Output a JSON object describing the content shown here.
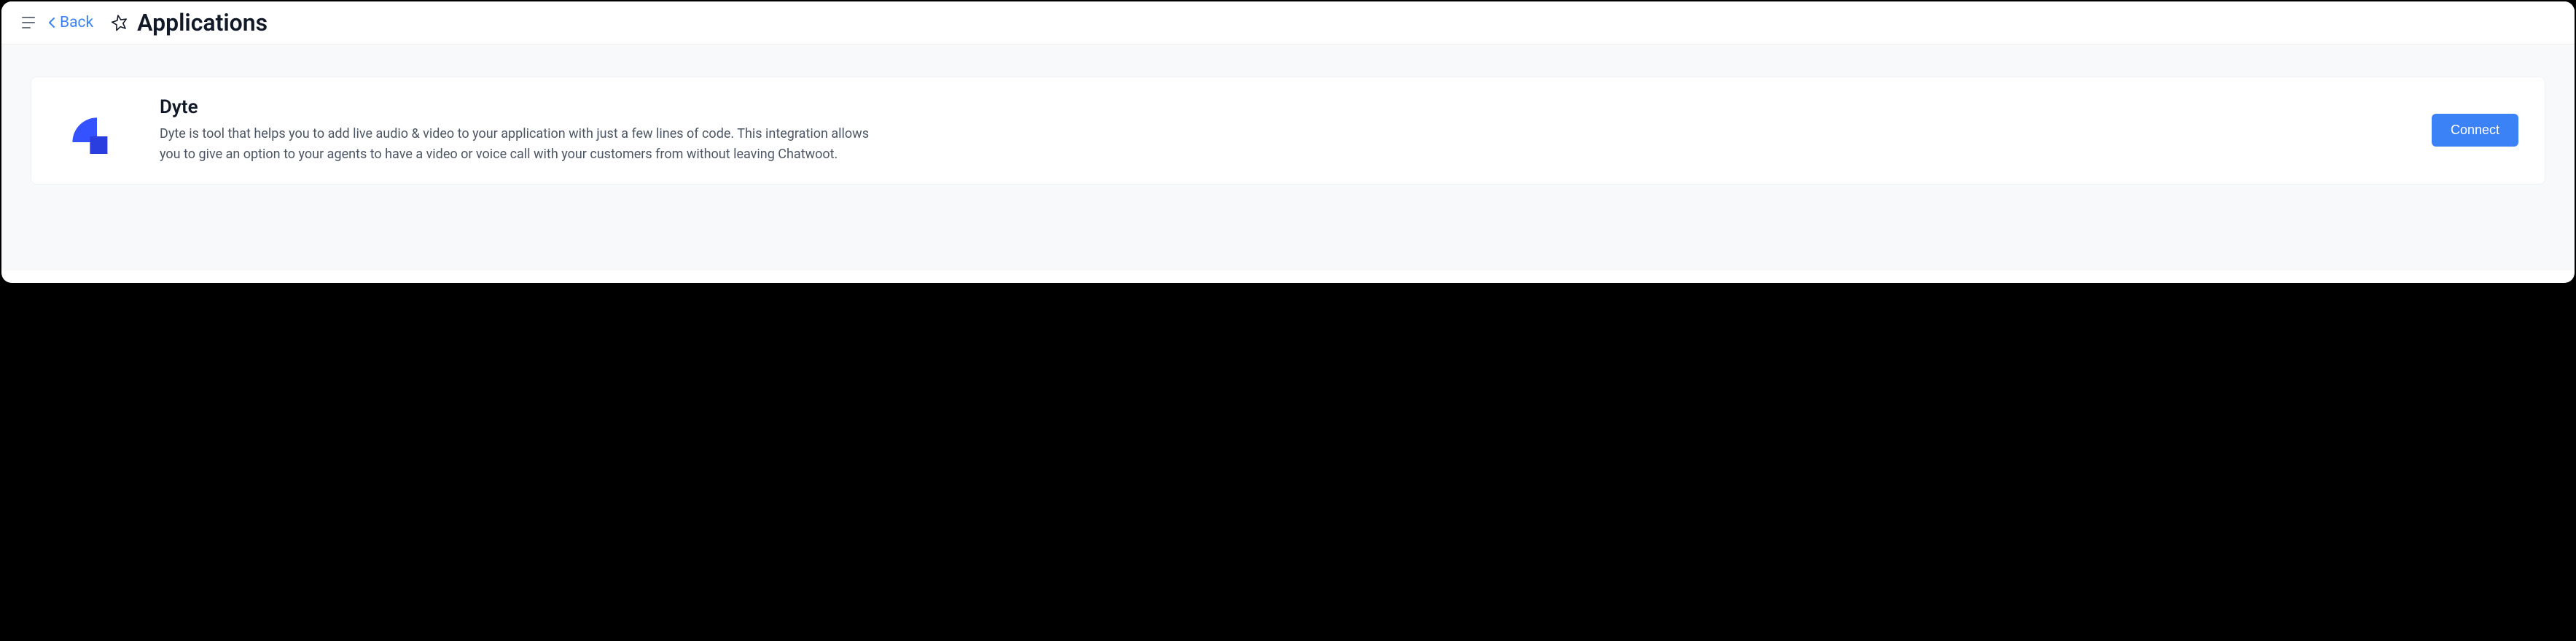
{
  "header": {
    "back_label": "Back",
    "title": "Applications"
  },
  "integrations": [
    {
      "name": "Dyte",
      "description": "Dyte is tool that helps you to add live audio & video to your application with just a few lines of code. This integration allows you to give an option to your agents to have a video or voice call with your customers from without leaving Chatwoot.",
      "action_label": "Connect",
      "logo_color_primary": "#3452ff",
      "logo_color_secondary": "#2a3ee0"
    }
  ]
}
